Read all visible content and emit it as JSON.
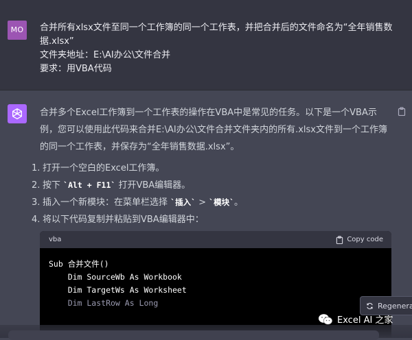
{
  "user": {
    "avatar_text": "MO",
    "lines": [
      "合并所有xlsx文件至同一个工作簿的同一个工作表，并把合并后的文件命名为“全年销售数据.xlsx”",
      "文件夹地址：E:\\AI办公\\文件合并",
      "要求：用VBA代码"
    ]
  },
  "assistant": {
    "intro": "合并多个Excel工作簿到一个工作表的操作在VBA中是常见的任务。以下是一个VBA示例，您可以使用此代码来合并E:\\AI办公\\文件合并文件夹内的所有.xlsx文件到一个工作簿的同一个工作表，并保存为“全年销售数据.xlsx”。",
    "steps": [
      {
        "num": "1.",
        "before": "打开一个空白的Excel工作簿。",
        "code": "",
        "after": "",
        "code2": "",
        "after2": ""
      },
      {
        "num": "2.",
        "before": "按下 ",
        "code": "`Alt + F11`",
        "after": " 打开VBA编辑器。",
        "code2": "",
        "after2": ""
      },
      {
        "num": "3.",
        "before": "插入一个新模块：在菜单栏选择 ",
        "code": "`插入`",
        "after": " > ",
        "code2": "`模块`",
        "after2": "。"
      },
      {
        "num": "4.",
        "before": "将以下代码复制并粘贴到VBA编辑器中：",
        "code": "",
        "after": "",
        "code2": "",
        "after2": ""
      }
    ],
    "code_block": {
      "language": "vba",
      "copy_label": "Copy code",
      "lines": [
        "Sub 合并文件()",
        "",
        "    Dim SourceWb As Workbook",
        "    Dim TargetWs As Worksheet",
        "    Dim LastRow As Long"
      ]
    }
  },
  "regenerate_label": "Regenerat",
  "watermark": "Excel AI 之家",
  "icons": {
    "assistant_avatar": "openai-logo-icon",
    "copy": "clipboard-icon",
    "regenerate": "refresh-icon",
    "watermark": "wechat-icon"
  },
  "colors": {
    "user_bg": "#343541",
    "assistant_bg": "#444654",
    "user_avatar": "#9c55b3",
    "assistant_avatar": "#ab68ff",
    "code_bg": "#000000"
  }
}
